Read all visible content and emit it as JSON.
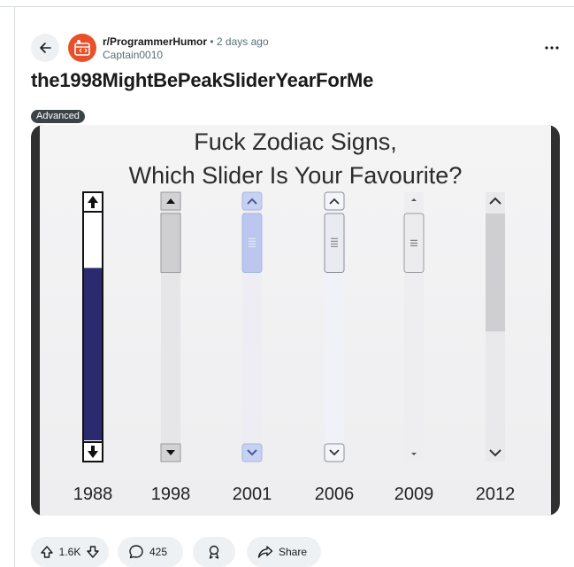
{
  "post": {
    "subreddit": "r/ProgrammerHumor",
    "separator": "•",
    "time": "2 days ago",
    "author": "Captain0010",
    "title": "the1998MightBePeakSliderYearForMe",
    "flair": "Advanced"
  },
  "image": {
    "heading_line1": "Fuck Zodiac Signs,",
    "heading_line2": "Which Slider Is Your Favourite?",
    "sliders": [
      {
        "year": "1988",
        "thumb_start": 0.24,
        "thumb_end": 1.0
      },
      {
        "year": "1998",
        "thumb_start": 0.0,
        "thumb_end": 0.26
      },
      {
        "year": "2001",
        "thumb_start": 0.0,
        "thumb_end": 0.26
      },
      {
        "year": "2006",
        "thumb_start": 0.0,
        "thumb_end": 0.26
      },
      {
        "year": "2009",
        "thumb_start": 0.0,
        "thumb_end": 0.26
      },
      {
        "year": "2012",
        "thumb_start": 0.0,
        "thumb_end": 0.52
      }
    ]
  },
  "actions": {
    "votes": "1.6K",
    "comments": "425",
    "share": "Share"
  },
  "colors": {
    "accent_avatar": "#e8502a",
    "slider_1988_thumb": "#2b2a6e",
    "chip_bg": "#eef1f3"
  }
}
